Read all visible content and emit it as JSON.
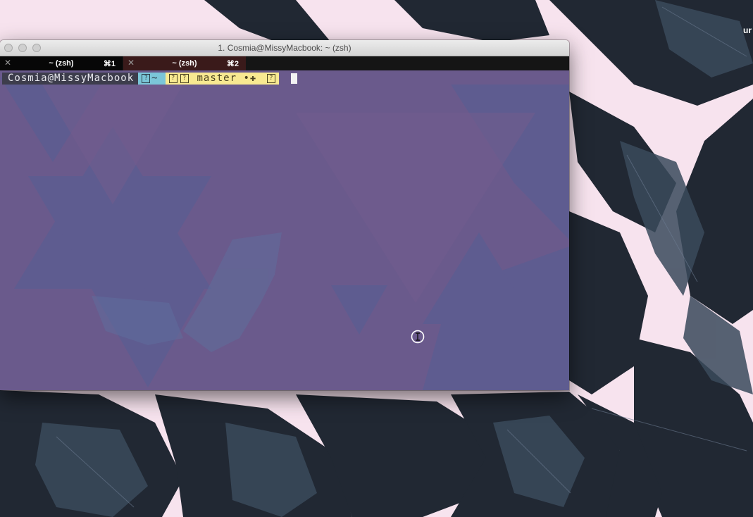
{
  "desktop": {
    "edge_text": "ur"
  },
  "window": {
    "title": "1. Cosmia@MissyMacbook: ~ (zsh)",
    "tabs": [
      {
        "label": "~ (zsh)",
        "shortcut": "⌘1",
        "active": true
      },
      {
        "label": "~ (zsh)",
        "shortcut": "⌘2",
        "active": false
      }
    ],
    "close_glyph": "✕"
  },
  "prompt": {
    "user_host": "Cosmia@MissyMacbook",
    "dir_icon": "?",
    "directory": "~",
    "git_icon_1": "?",
    "git_icon_2": "?",
    "branch": "master",
    "status": "•✚",
    "end_icon": "?"
  },
  "colors": {
    "terminal_bg": "#6a5a8c",
    "user_segment": "#3d3d4c",
    "dir_segment": "#7bc6d8",
    "git_segment": "#f8e991",
    "wallpaper_bg": "#f7e3ee",
    "leaf_dark": "#1f252e"
  },
  "icons": [
    "close-button",
    "minimize-button",
    "zoom-button",
    "tab-close-icon",
    "text-cursor-ibeam-icon"
  ]
}
